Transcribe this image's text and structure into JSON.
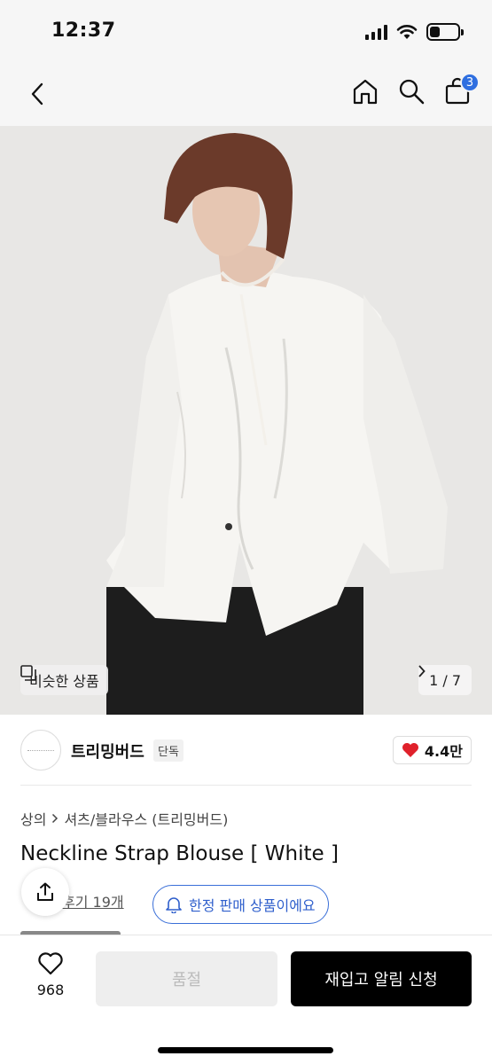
{
  "status_bar": {
    "time": "12:37",
    "battery_level": 0.35
  },
  "nav": {
    "cart_count": "3",
    "icons": [
      "back-icon",
      "home-icon",
      "search-icon",
      "shopping-bag-icon"
    ],
    "badge_color": "#2f6fe0"
  },
  "hero": {
    "similar_label": "비슷한 상품",
    "page_indicator": "1 / 7"
  },
  "brand": {
    "name": "트리밍버드",
    "tag": "단독",
    "likes": "4.4만",
    "heart_color": "#e0212b"
  },
  "product": {
    "breadcrumb_1": "상의",
    "breadcrumb_2": "셔츠/블라우스 (트리밍버드)",
    "title": "Neckline Strap Blouse [ White ]",
    "reviews": "후기 19개",
    "limited_label": "한정 판매 상품이에요",
    "accent_color": "#3a6fd8"
  },
  "bottom": {
    "wish_count": "968",
    "soldout_label": "품절",
    "restock_label": "재입고 알림 신청"
  }
}
